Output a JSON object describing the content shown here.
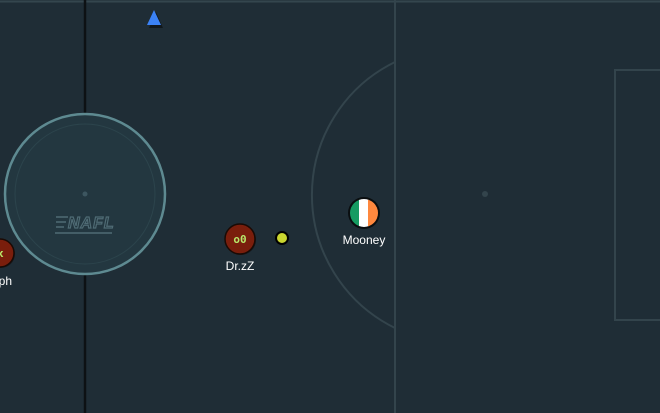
{
  "field": {
    "logo_text": "NAFL",
    "colors": {
      "pitch": "#1f2d36",
      "lines": "#34464e",
      "kickoff_line": "#0d1114",
      "center_circle": "#5e8a91",
      "ball": "#c9d630",
      "pointer": "#3b82f6"
    }
  },
  "players": [
    {
      "name": "Dr.zZ",
      "avatar_text": "o0",
      "avatar_type": "red-text"
    },
    {
      "name": "Mooney",
      "avatar_text": "",
      "avatar_type": "ireland-flag"
    },
    {
      "name": "raph",
      "avatar_text": "x",
      "avatar_type": "red-text"
    }
  ],
  "ball": {
    "color": "#c9d630"
  },
  "pointer": {
    "icon": "blue-triangle-marker"
  }
}
